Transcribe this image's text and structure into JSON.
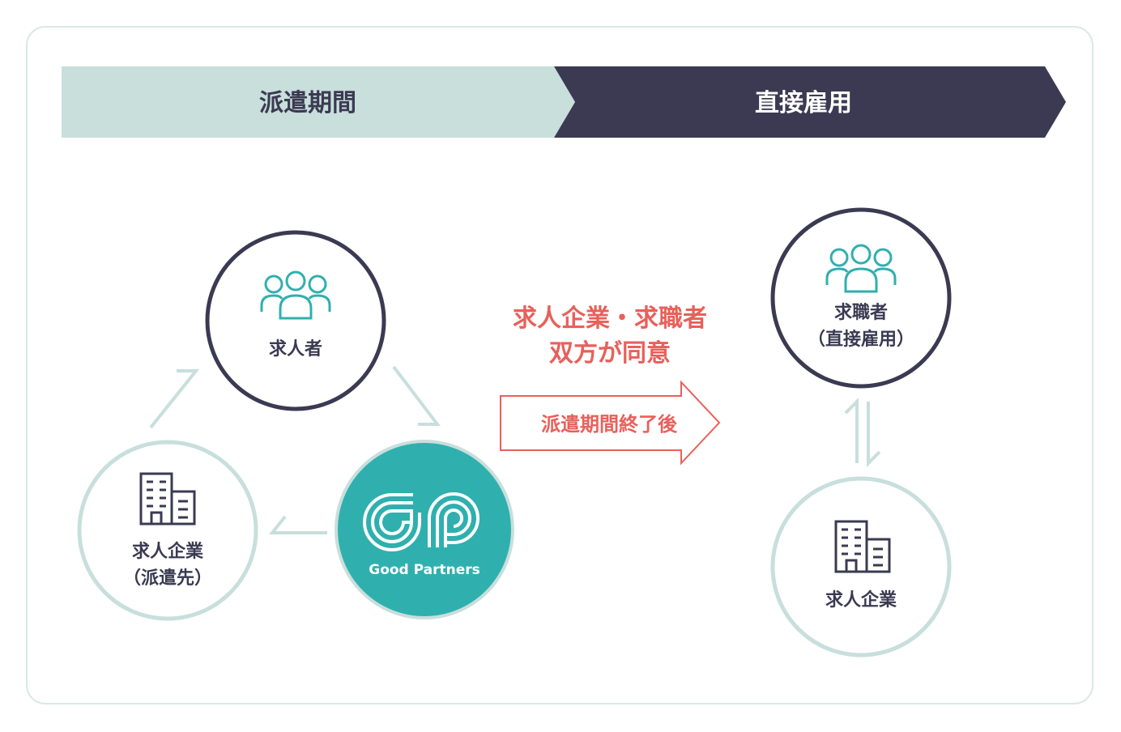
{
  "phases": {
    "dispatch_label": "派遣期間",
    "direct_label": "直接雇用"
  },
  "left": {
    "jobseeker_label": "求人者",
    "company_line1": "求人企業",
    "company_line2": "（派遣先）",
    "logo_text": "Good Partners"
  },
  "middle": {
    "agree_line1": "求人企業・求職者",
    "agree_line2": "双方が同意",
    "arrow_label": "派遣期間終了後"
  },
  "right": {
    "jobseeker_line1": "求職者",
    "jobseeker_line2": "（直接雇用）",
    "company_label": "求人企業"
  },
  "colors": {
    "dispatch_bg": "#c8dfdc",
    "direct_bg": "#3b3a52",
    "dark_ring": "#3b3a52",
    "light_ring": "#c8dfdc",
    "teal": "#2fb0ae",
    "accent_red": "#e8605a"
  }
}
